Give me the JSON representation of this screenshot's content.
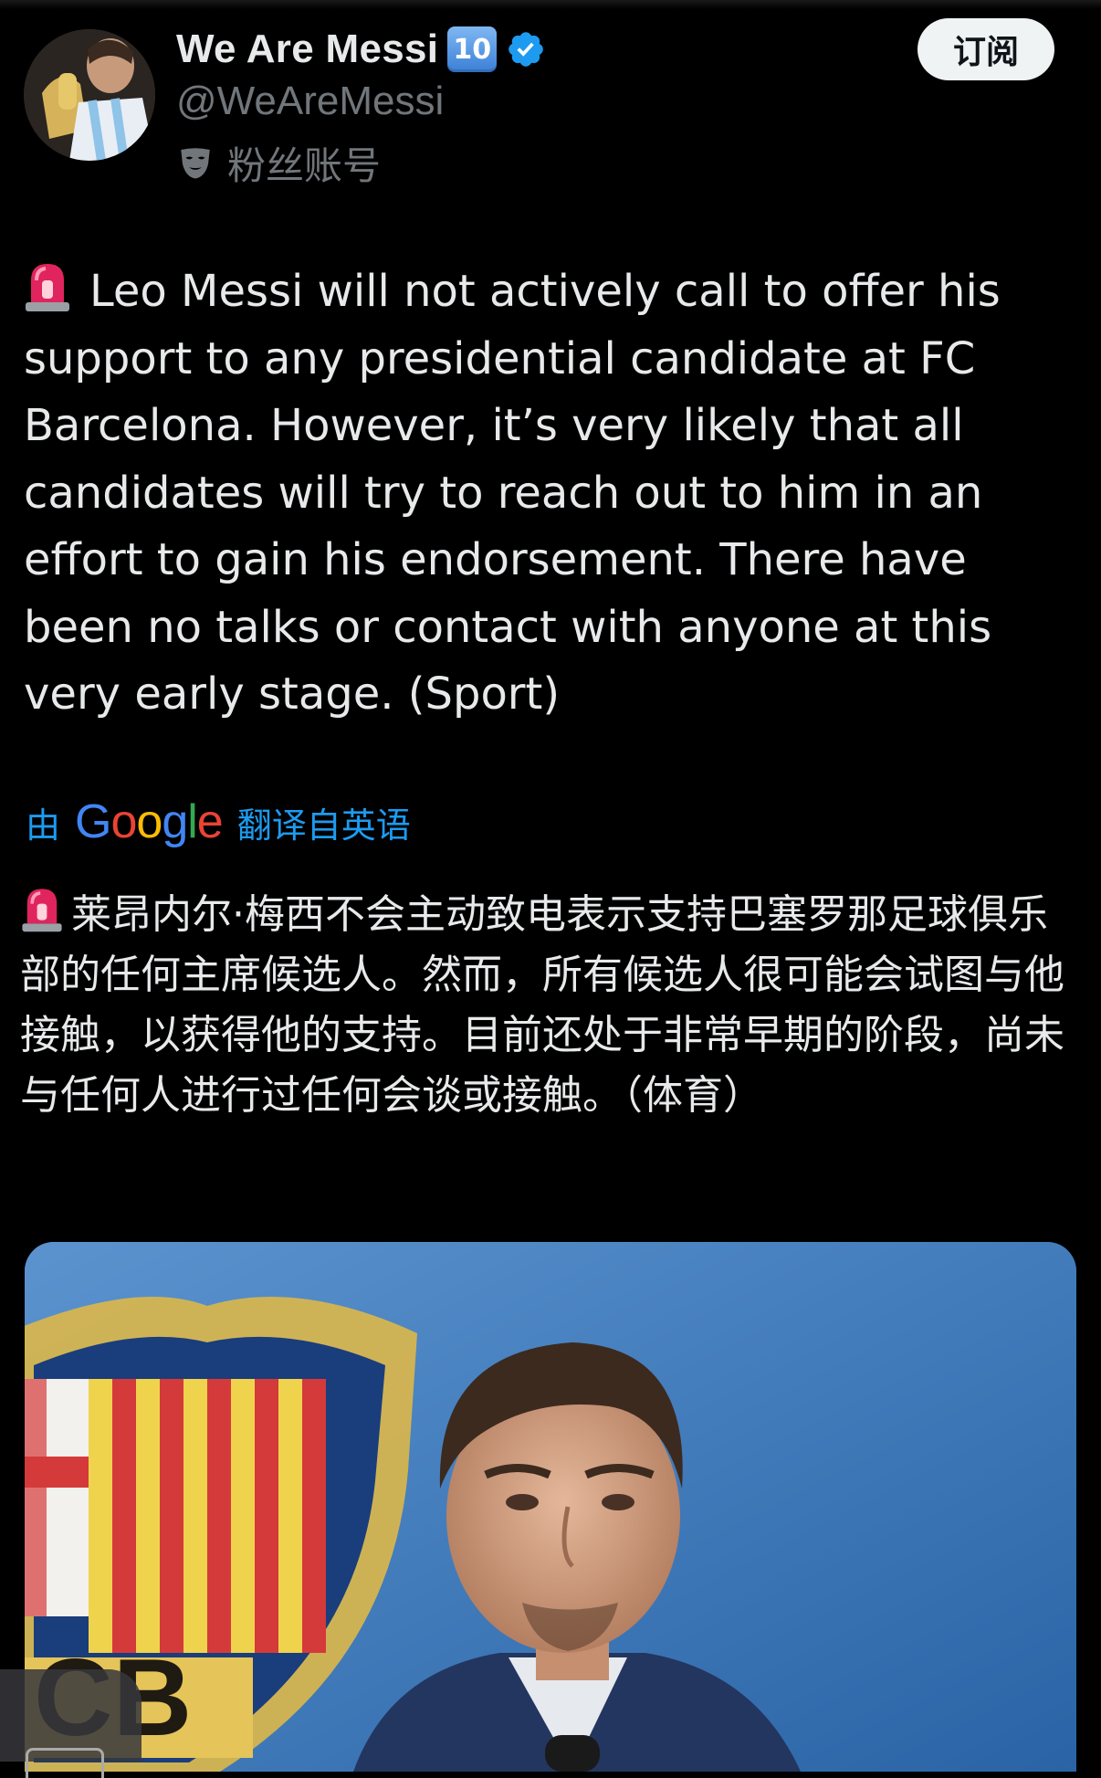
{
  "account": {
    "display_name": "We Are Messi",
    "number_badge": "10",
    "verified": true,
    "handle": "@WeAreMessi",
    "fan_label": "粉丝账号",
    "subscribe_label": "订阅",
    "avatar_icon": "avatar-photo",
    "badge_icon": "keycap-10-icon",
    "verified_icon": "verified-check-icon",
    "fan_icon": "mask-icon"
  },
  "tweet": {
    "text": "Leo Messi will not actively call to offer his support to any presidential candidate at FC Barcelona. However, it’s very likely that all candidates will try to reach out to him in an effort to gain his endorsement. There have been no talks or contact with anyone at this very early stage. (Sport)",
    "leading_icon": "siren-icon"
  },
  "translation": {
    "prefix": "由",
    "provider": "Google",
    "suffix": "翻译自英语",
    "text": "莱昂内尔·梅西不会主动致电表示支持巴塞罗那足球俱乐部的任何主席候选人。然而，所有候选人很可能会试图与他接触，以获得他的支持。目前还处于非常早期的阶段，尚未与任何人进行过任何会谈或接触。（体育）"
  },
  "media": {
    "crest_letters": "CB",
    "image_icon": "photo-barcelona-crest-messi"
  },
  "colors": {
    "background": "#000000",
    "text": "#e7e9ea",
    "secondary_text": "#71767b",
    "link": "#1d9bf0",
    "verified": "#1d9bf0",
    "subscribe_bg": "#eff3f4",
    "google_blue": "#4285f4",
    "google_red": "#ea4335",
    "google_yellow": "#fbbc05",
    "google_green": "#34a853"
  }
}
